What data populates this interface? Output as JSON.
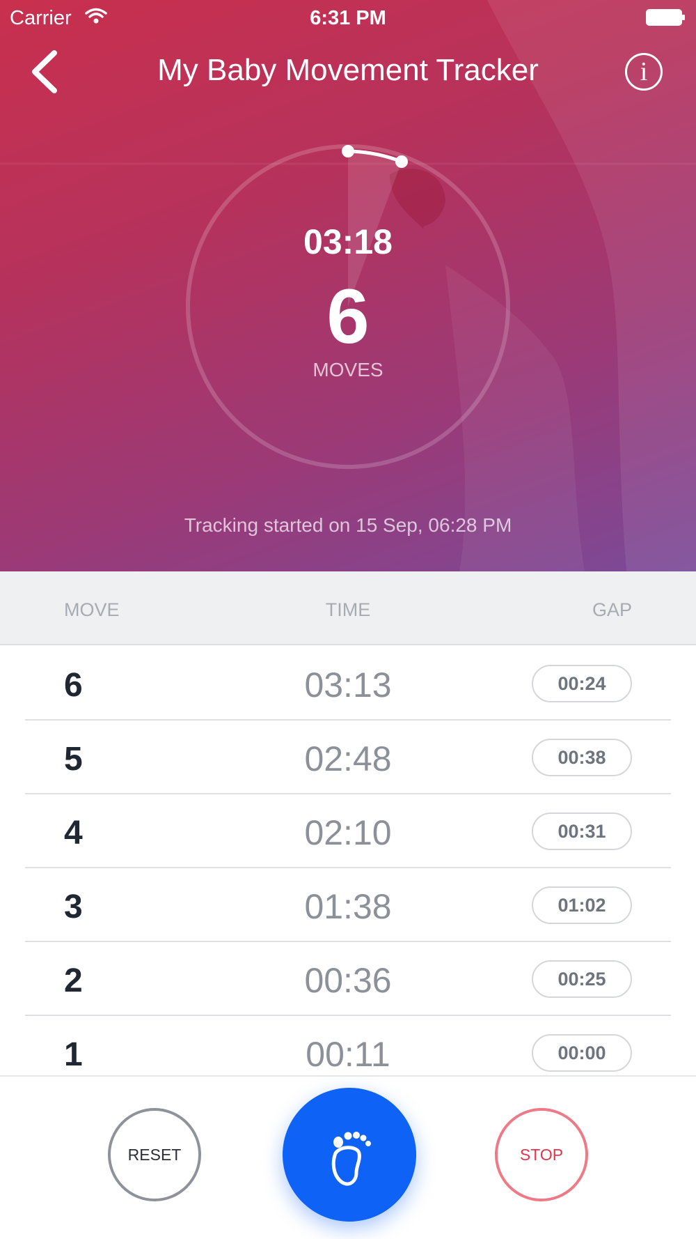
{
  "status_bar": {
    "carrier": "Carrier",
    "time": "6:31 PM"
  },
  "header": {
    "title": "My Baby Movement Tracker",
    "info_label": "i"
  },
  "timer": {
    "elapsed": "03:18",
    "moves": "6",
    "moves_label": "MOVES",
    "tracking_started": "Tracking started on 15 Sep, 06:28 PM"
  },
  "table": {
    "headers": {
      "move": "MOVE",
      "time": "TIME",
      "gap": "GAP"
    },
    "rows": [
      {
        "move": "6",
        "time": "03:13",
        "gap": "00:24"
      },
      {
        "move": "5",
        "time": "02:48",
        "gap": "00:38"
      },
      {
        "move": "4",
        "time": "02:10",
        "gap": "00:31"
      },
      {
        "move": "3",
        "time": "01:38",
        "gap": "01:02"
      },
      {
        "move": "2",
        "time": "00:36",
        "gap": "00:25"
      },
      {
        "move": "1",
        "time": "00:11",
        "gap": "00:00"
      }
    ]
  },
  "actions": {
    "reset": "RESET",
    "stop": "STOP"
  },
  "colors": {
    "hero_gradient_start": "#c9304e",
    "hero_gradient_end": "#7a4a98",
    "primary_blue": "#0e62f5",
    "stop_red": "#e5334a"
  },
  "icons": [
    "wifi-icon",
    "battery-icon",
    "back-chevron-icon",
    "info-icon",
    "footprint-icon"
  ]
}
